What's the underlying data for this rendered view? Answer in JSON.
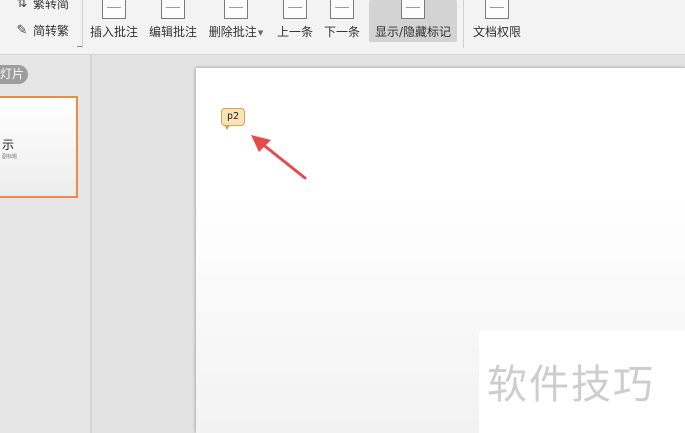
{
  "ribbon": {
    "convert": {
      "trad_to_simp": {
        "label": "繁转简",
        "icon": "trad-to-simp-icon"
      },
      "simp_to_trad": {
        "label": "简转繁",
        "icon": "simp-to-trad-icon"
      }
    },
    "buttons": [
      {
        "label": "插入批注",
        "icon": "insert-comment-icon"
      },
      {
        "label": "编辑批注",
        "icon": "edit-comment-icon"
      },
      {
        "label": "删除批注",
        "icon": "delete-comment-icon",
        "has_dropdown": true
      },
      {
        "label": "上一条",
        "icon": "previous-comment-icon"
      },
      {
        "label": "下一条",
        "icon": "next-comment-icon"
      },
      {
        "label": "显示/隐藏标记",
        "icon": "show-hide-markup-icon",
        "active": true
      },
      {
        "label": "文档权限",
        "icon": "document-permission-icon"
      }
    ]
  },
  "left_panel": {
    "tab_label": "灯片",
    "thumbnail": {
      "title": "示",
      "subtitle": "副标题"
    }
  },
  "slide": {
    "comment_marker": "p2",
    "arrow_color": "#e84a4a"
  },
  "watermark": "软件技巧",
  "colors": {
    "thumbnail_border": "#f08a4b",
    "marker_fill": "#fbe2b8",
    "marker_border": "#d9a24f"
  }
}
